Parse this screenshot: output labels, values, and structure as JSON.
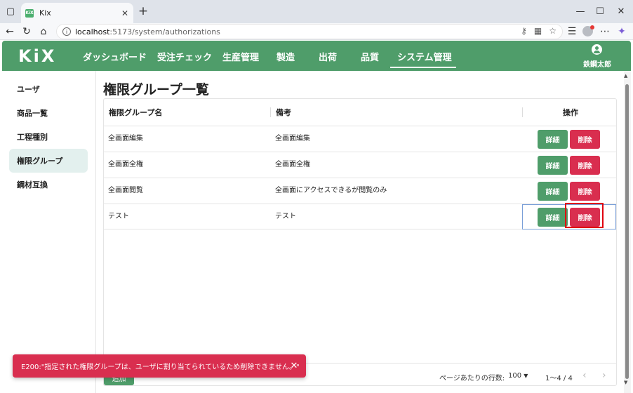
{
  "browser": {
    "tab_title": "Kix",
    "favicon_text": "KiX",
    "url_host": "localhost",
    "url_path": ":5173/system/authorizations"
  },
  "app": {
    "logo": "KiX",
    "nav": [
      {
        "label": "ダッシュボード"
      },
      {
        "label": "受注チェック"
      },
      {
        "label": "生産管理"
      },
      {
        "label": "製造"
      },
      {
        "label": "出荷"
      },
      {
        "label": "品質"
      },
      {
        "label": "システム管理",
        "active": true
      }
    ],
    "user_name": "鉄鋼太郎",
    "accent_color": "#4f9d6a",
    "danger_color": "#d92e4f"
  },
  "sidebar": {
    "items": [
      {
        "label": "ユーザ"
      },
      {
        "label": "商品一覧"
      },
      {
        "label": "工程種別"
      },
      {
        "label": "権限グループ",
        "active": true
      },
      {
        "label": "鋼材互換"
      }
    ]
  },
  "page": {
    "title": "権限グループ一覧"
  },
  "table": {
    "columns": [
      "権限グループ名",
      "備考",
      "操作"
    ],
    "rows": [
      {
        "name": "全画面編集",
        "note": "全画面編集",
        "detail": "詳細",
        "delete": "削除"
      },
      {
        "name": "全画面全権",
        "note": "全画面全権",
        "detail": "詳細",
        "delete": "削除"
      },
      {
        "name": "全画面閲覧",
        "note": "全画面にアクセスできるが閲覧のみ",
        "detail": "詳細",
        "delete": "削除"
      },
      {
        "name": "テスト",
        "note": "テスト",
        "detail": "詳細",
        "delete": "削除"
      }
    ]
  },
  "footer": {
    "add_label": "追加",
    "rows_per_page_label": "ページあたりの行数:",
    "rows_per_page_value": "100",
    "range": "1〜4 / 4"
  },
  "toast": {
    "message": "E200:\"指定された権限グループは、ユーザに割り当てられているため削除できません。\""
  }
}
